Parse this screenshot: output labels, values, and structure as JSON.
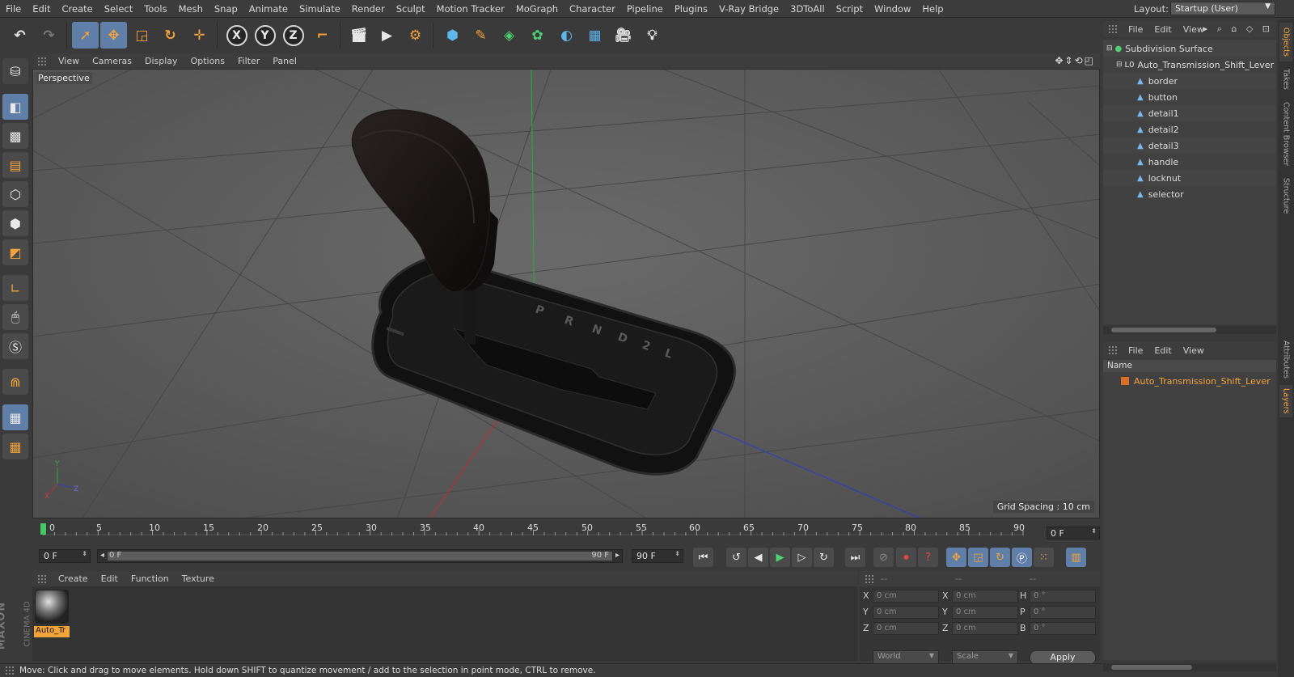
{
  "menubar": {
    "items": [
      "File",
      "Edit",
      "Create",
      "Select",
      "Tools",
      "Mesh",
      "Snap",
      "Animate",
      "Simulate",
      "Render",
      "Sculpt",
      "Motion Tracker",
      "MoGraph",
      "Character",
      "Pipeline",
      "Plugins",
      "V-Ray Bridge",
      "3DToAll",
      "Script",
      "Window",
      "Help"
    ],
    "layout_label": "Layout:",
    "layout_value": "Startup (User)"
  },
  "toolbar": {
    "axis_x": "X",
    "axis_y": "Y",
    "axis_z": "Z"
  },
  "viewport": {
    "menu": [
      "View",
      "Cameras",
      "Display",
      "Options",
      "Filter",
      "Panel"
    ],
    "camera_label": "Perspective",
    "grid_spacing": "Grid Spacing : 10 cm",
    "axis_labels": {
      "y": "Y",
      "z": "Z",
      "x": "X"
    }
  },
  "timeline": {
    "ticks": [
      "0",
      "5",
      "10",
      "15",
      "20",
      "25",
      "30",
      "35",
      "40",
      "45",
      "50",
      "55",
      "60",
      "65",
      "70",
      "75",
      "80",
      "85",
      "90"
    ],
    "current_frame": "0 F"
  },
  "transport": {
    "start_frame": "0 F",
    "range_start": "0 F",
    "range_end": "90 F",
    "end_frame": "90 F"
  },
  "materials": {
    "menu": [
      "Create",
      "Edit",
      "Function",
      "Texture"
    ],
    "material_name": "Auto_Tr"
  },
  "coordinates": {
    "headers": [
      "--",
      "--",
      "--"
    ],
    "rows": [
      {
        "l1": "X",
        "v1": "0 cm",
        "l2": "X",
        "v2": "0 cm",
        "l3": "H",
        "v3": "0 °"
      },
      {
        "l1": "Y",
        "v1": "0 cm",
        "l2": "Y",
        "v2": "0 cm",
        "l3": "P",
        "v3": "0 °"
      },
      {
        "l1": "Z",
        "v1": "0 cm",
        "l2": "Z",
        "v2": "0 cm",
        "l3": "B",
        "v3": "0 °"
      }
    ],
    "mode": "World",
    "transform": "Scale",
    "apply_label": "Apply"
  },
  "branding": {
    "maxon": "MAXON",
    "product": "CINEMA 4D"
  },
  "statusbar": {
    "message": "Move: Click and drag to move elements. Hold down SHIFT to quantize movement / add to the selection in point mode, CTRL to remove."
  },
  "objects": {
    "menu": [
      "File",
      "Edit",
      "View"
    ],
    "tree": [
      {
        "label": "Subdivision Surface",
        "level": 0,
        "kind": "subdiv"
      },
      {
        "label": "Auto_Transmission_Shift_Lever",
        "level": 1,
        "kind": "null"
      },
      {
        "label": "border",
        "level": 2,
        "kind": "poly"
      },
      {
        "label": "button",
        "level": 2,
        "kind": "poly"
      },
      {
        "label": "detail1",
        "level": 2,
        "kind": "poly"
      },
      {
        "label": "detail2",
        "level": 2,
        "kind": "poly"
      },
      {
        "label": "detail3",
        "level": 2,
        "kind": "poly"
      },
      {
        "label": "handle",
        "level": 2,
        "kind": "poly"
      },
      {
        "label": "locknut",
        "level": 2,
        "kind": "poly"
      },
      {
        "label": "selector",
        "level": 2,
        "kind": "poly"
      }
    ]
  },
  "layers": {
    "menu": [
      "File",
      "Edit",
      "View"
    ],
    "column_name": "Name",
    "row_label": "Auto_Transmission_Shift_Lever",
    "row_color": "#d9702a"
  },
  "side_tabs": [
    "Objects",
    "Takes",
    "Content Browser",
    "Structure",
    "Attributes",
    "Layers"
  ],
  "colors": {
    "accent": "#f2a33a",
    "active_blue": "#5f7fa8",
    "timeline_marker": "#45c864"
  }
}
